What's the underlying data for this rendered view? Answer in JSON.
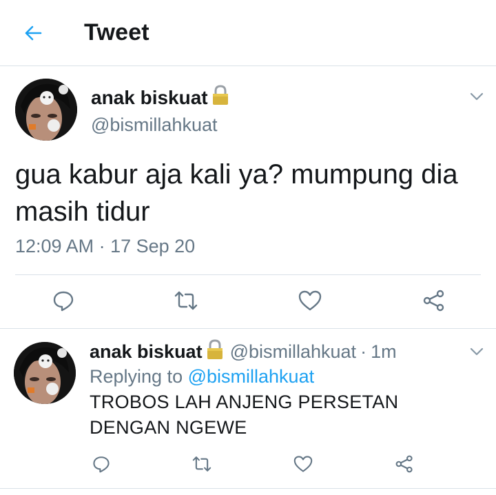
{
  "header": {
    "title": "Tweet",
    "back_icon": "back-arrow-icon"
  },
  "colors": {
    "accent": "#1da1f2",
    "text": "#14171a",
    "secondary": "#657786",
    "divider": "#d9e1e8"
  },
  "main_tweet": {
    "author_name": "anak biskuat",
    "handle": "@bismillahkuat",
    "protected_icon": "lock-icon",
    "text": "gua kabur aja kali ya? mumpung dia masih tidur",
    "timestamp": "12:09 AM · 17 Sep 20",
    "actions": [
      "reply-icon",
      "retweet-icon",
      "like-icon",
      "share-icon"
    ]
  },
  "reply": {
    "author_name": "anak biskuat",
    "handle": "@bismillahkuat",
    "separator": "·",
    "time": "1m",
    "replying_prefix": "Replying to",
    "replying_to": "@bismillahkuat",
    "text": "TROBOS LAH ANJENG PERSETAN DENGAN NGEWE",
    "actions": [
      "reply-icon",
      "retweet-icon",
      "like-icon",
      "share-icon"
    ]
  }
}
